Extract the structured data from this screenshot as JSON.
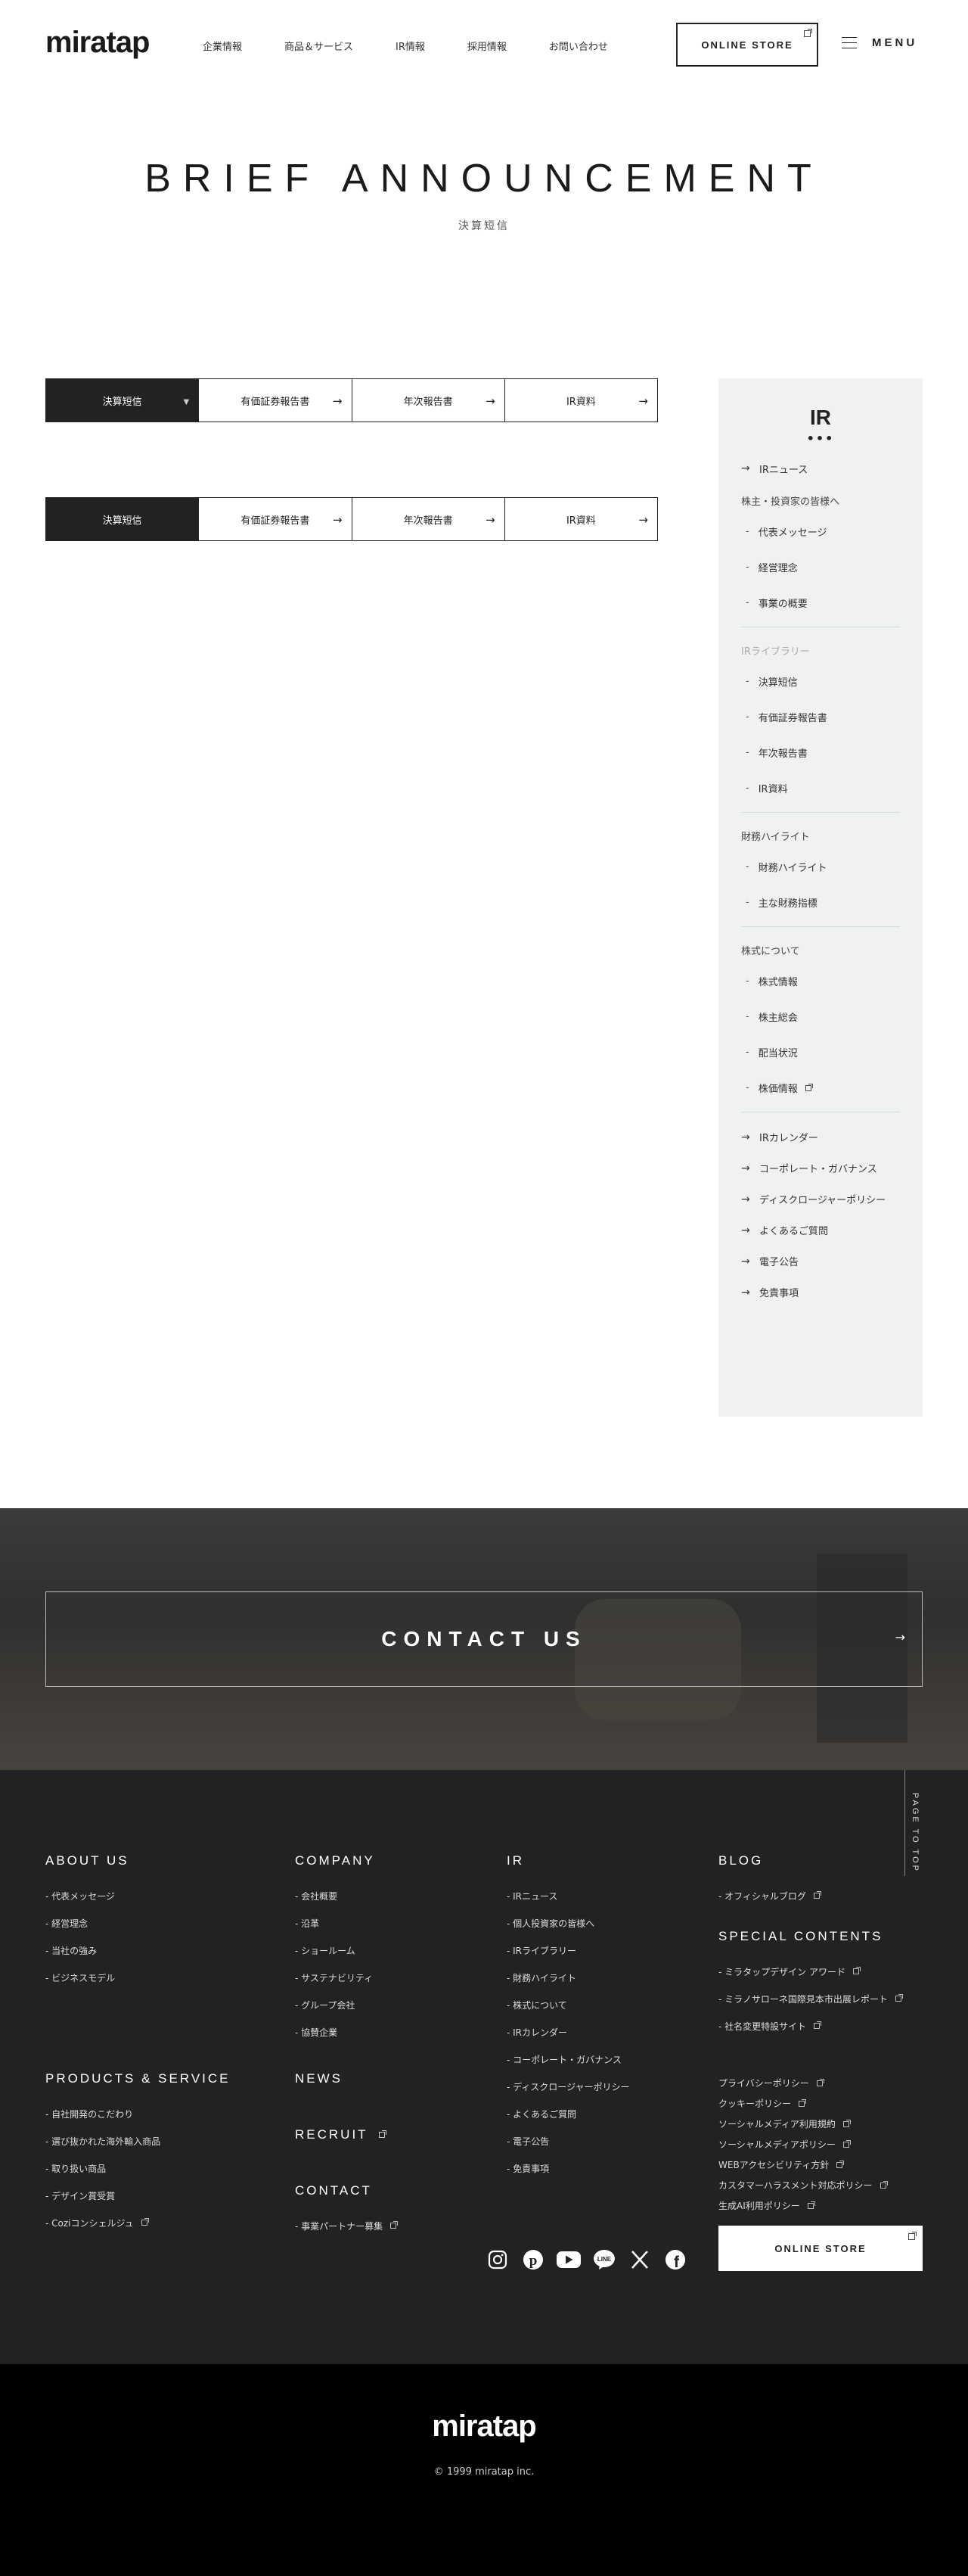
{
  "header": {
    "logo": "miratap",
    "nav": [
      "企業情報",
      "商品＆サービス",
      "IR情報",
      "採用情報",
      "お問い合わせ"
    ],
    "store_label": "ONLINE STORE",
    "menu_label": "MENU"
  },
  "hero": {
    "title": "BRIEF ANNOUNCEMENT",
    "subtitle": "決算短信"
  },
  "tabs": [
    {
      "label": "決算短信",
      "active": true
    },
    {
      "label": "有価証券報告書"
    },
    {
      "label": "年次報告書"
    },
    {
      "label": "IR資料"
    }
  ],
  "sidebar": {
    "title": "IR",
    "dots": "•••",
    "news": "IRニュース",
    "group1": {
      "label": "株主・投資家の皆様へ",
      "items": [
        "代表メッセージ",
        "経営理念",
        "事業の概要"
      ]
    },
    "group2": {
      "label": "IRライブラリー",
      "items": [
        "決算短信",
        "有価証券報告書",
        "年次報告書",
        "IR資料"
      ]
    },
    "group3": {
      "label": "財務ハイライト",
      "items": [
        "財務ハイライト",
        "主な財務指標"
      ]
    },
    "group4": {
      "label": "株式について",
      "items": [
        "株式情報",
        "株主総会",
        "配当状況",
        "株価情報"
      ]
    },
    "links": [
      "IRカレンダー",
      "コーポレート・ガバナンス",
      "ディスクロージャーポリシー",
      "よくあるご質問",
      "電子公告",
      "免責事項"
    ]
  },
  "contact": {
    "label": "CONTACT US"
  },
  "footer": {
    "pagetop": "PAGE TO TOP",
    "about": {
      "head": "ABOUT US",
      "items": [
        "- 代表メッセージ",
        "- 経営理念",
        "- 当社の強み",
        "- ビジネスモデル"
      ]
    },
    "products": {
      "head": "PRODUCTS & SERVICE",
      "items": [
        "- 自社開発のこだわり",
        "- 選び抜かれた海外輸入商品",
        "- 取り扱い商品",
        "- デザイン賞受賞",
        "- Coziコンシェルジュ"
      ]
    },
    "company": {
      "head": "COMPANY",
      "items": [
        "- 会社概要",
        "- 沿革",
        "- ショールーム",
        "- サステナビリティ",
        "- グループ会社",
        "- 協賛企業"
      ]
    },
    "news": "NEWS",
    "recruit": "RECRUIT",
    "contact": {
      "head": "CONTACT",
      "items": [
        "- 事業パートナー募集"
      ]
    },
    "ir": {
      "head": "IR",
      "items": [
        "- IRニュース",
        "- 個人投資家の皆様へ",
        "- IRライブラリー",
        "- 財務ハイライト",
        "- 株式について",
        "- IRカレンダー",
        "- コーポレート・ガバナンス",
        "- ディスクロージャーポリシー",
        "- よくあるご質問",
        "- 電子公告",
        "- 免責事項"
      ]
    },
    "blog": {
      "head": "BLOG",
      "items": [
        "- オフィシャルブログ"
      ]
    },
    "special": {
      "head": "SPECIAL CONTENTS",
      "items": [
        "- ミラタップデザイン アワード",
        "- ミラノサローネ国際見本市出展レポート",
        "- 社名変更特設サイト"
      ]
    },
    "policies": [
      "プライバシーポリシー",
      "クッキーポリシー",
      "ソーシャルメディア利用規約",
      "ソーシャルメディアポリシー",
      "WEBアクセシビリティ方針",
      "カスタマーハラスメント対応ポリシー",
      "生成AI利用ポリシー"
    ],
    "social": [
      "instagram-icon",
      "pinterest-icon",
      "youtube-icon",
      "line-icon",
      "x-icon",
      "facebook-icon"
    ],
    "store_label": "ONLINE STORE",
    "bottom_logo": "miratap",
    "copyright": "© 1999 miratap inc."
  }
}
